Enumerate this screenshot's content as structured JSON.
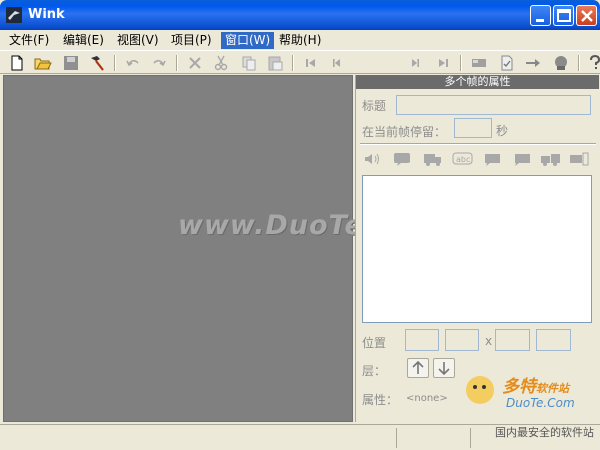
{
  "window": {
    "title": "Wink"
  },
  "menu": [
    {
      "label": "文件(F)"
    },
    {
      "label": "编辑(E)"
    },
    {
      "label": "视图(V)"
    },
    {
      "label": "项目(P)"
    },
    {
      "label": "窗口(W)"
    },
    {
      "label": "帮助(H)"
    }
  ],
  "panel": {
    "header": "多个帧的属性",
    "title_label": "标题",
    "title_value": "",
    "stay_label": "在当前帧停留：",
    "stay_value": "",
    "stay_unit": "秒",
    "position_label": "位置",
    "position_sep": "x",
    "layer_label": "层：",
    "attr_label": "属性：",
    "attr_value": "<none>"
  },
  "canvas": {
    "watermark": "www.DuoTe.com"
  },
  "branding": {
    "brand": "多特",
    "brand_small": "软件站",
    "site": "DuoTe.Com",
    "tagline": "国内最安全的软件站"
  },
  "colors": {
    "title_bar": "#0058ee",
    "menu_active": "#316ac5",
    "canvas": "#808080",
    "panel_header": "#6b6b6b"
  }
}
